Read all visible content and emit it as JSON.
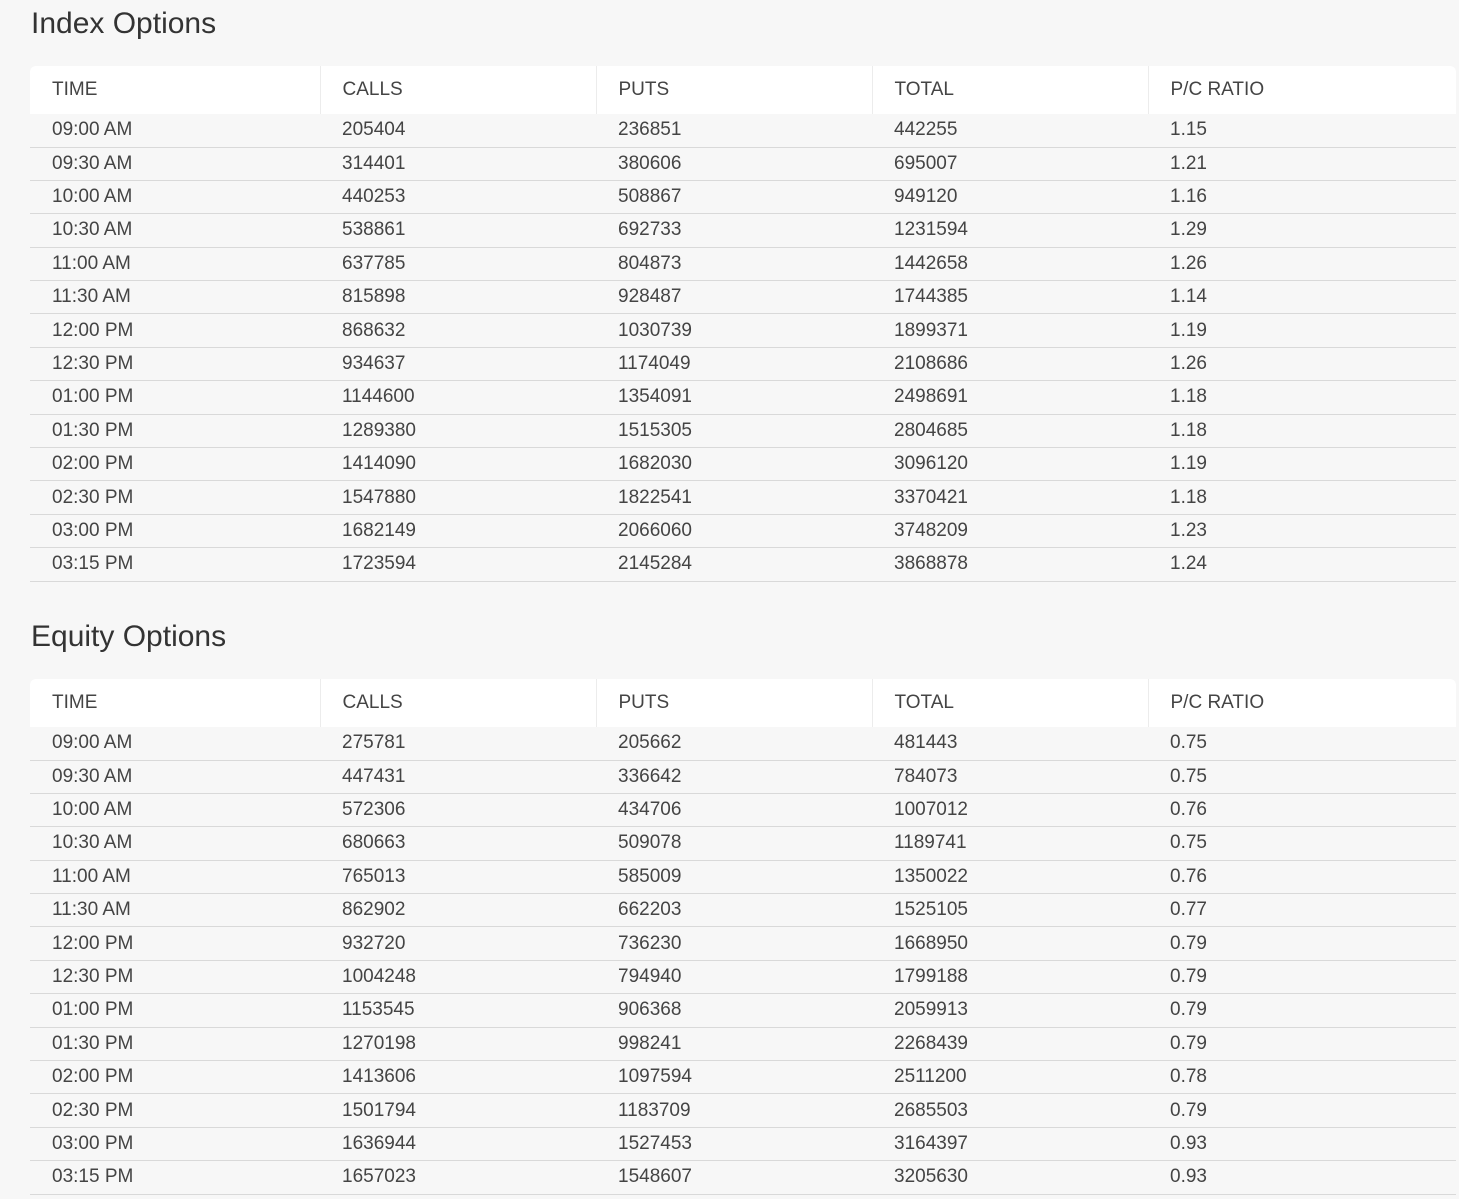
{
  "columns": [
    "TIME",
    "CALLS",
    "PUTS",
    "TOTAL",
    "P/C RATIO"
  ],
  "index_options": {
    "title": "Index Options",
    "rows": [
      [
        "09:00 AM",
        "205404",
        "236851",
        "442255",
        "1.15"
      ],
      [
        "09:30 AM",
        "314401",
        "380606",
        "695007",
        "1.21"
      ],
      [
        "10:00 AM",
        "440253",
        "508867",
        "949120",
        "1.16"
      ],
      [
        "10:30 AM",
        "538861",
        "692733",
        "1231594",
        "1.29"
      ],
      [
        "11:00 AM",
        "637785",
        "804873",
        "1442658",
        "1.26"
      ],
      [
        "11:30 AM",
        "815898",
        "928487",
        "1744385",
        "1.14"
      ],
      [
        "12:00 PM",
        "868632",
        "1030739",
        "1899371",
        "1.19"
      ],
      [
        "12:30 PM",
        "934637",
        "1174049",
        "2108686",
        "1.26"
      ],
      [
        "01:00 PM",
        "1144600",
        "1354091",
        "2498691",
        "1.18"
      ],
      [
        "01:30 PM",
        "1289380",
        "1515305",
        "2804685",
        "1.18"
      ],
      [
        "02:00 PM",
        "1414090",
        "1682030",
        "3096120",
        "1.19"
      ],
      [
        "02:30 PM",
        "1547880",
        "1822541",
        "3370421",
        "1.18"
      ],
      [
        "03:00 PM",
        "1682149",
        "2066060",
        "3748209",
        "1.23"
      ],
      [
        "03:15 PM",
        "1723594",
        "2145284",
        "3868878",
        "1.24"
      ]
    ]
  },
  "equity_options": {
    "title": "Equity Options",
    "rows": [
      [
        "09:00 AM",
        "275781",
        "205662",
        "481443",
        "0.75"
      ],
      [
        "09:30 AM",
        "447431",
        "336642",
        "784073",
        "0.75"
      ],
      [
        "10:00 AM",
        "572306",
        "434706",
        "1007012",
        "0.76"
      ],
      [
        "10:30 AM",
        "680663",
        "509078",
        "1189741",
        "0.75"
      ],
      [
        "11:00 AM",
        "765013",
        "585009",
        "1350022",
        "0.76"
      ],
      [
        "11:30 AM",
        "862902",
        "662203",
        "1525105",
        "0.77"
      ],
      [
        "12:00 PM",
        "932720",
        "736230",
        "1668950",
        "0.79"
      ],
      [
        "12:30 PM",
        "1004248",
        "794940",
        "1799188",
        "0.79"
      ],
      [
        "01:00 PM",
        "1153545",
        "906368",
        "2059913",
        "0.79"
      ],
      [
        "01:30 PM",
        "1270198",
        "998241",
        "2268439",
        "0.79"
      ],
      [
        "02:00 PM",
        "1413606",
        "1097594",
        "2511200",
        "0.78"
      ],
      [
        "02:30 PM",
        "1501794",
        "1183709",
        "2685503",
        "0.79"
      ],
      [
        "03:00 PM",
        "1636944",
        "1527453",
        "3164397",
        "0.93"
      ],
      [
        "03:15 PM",
        "1657023",
        "1548607",
        "3205630",
        "0.93"
      ]
    ]
  }
}
